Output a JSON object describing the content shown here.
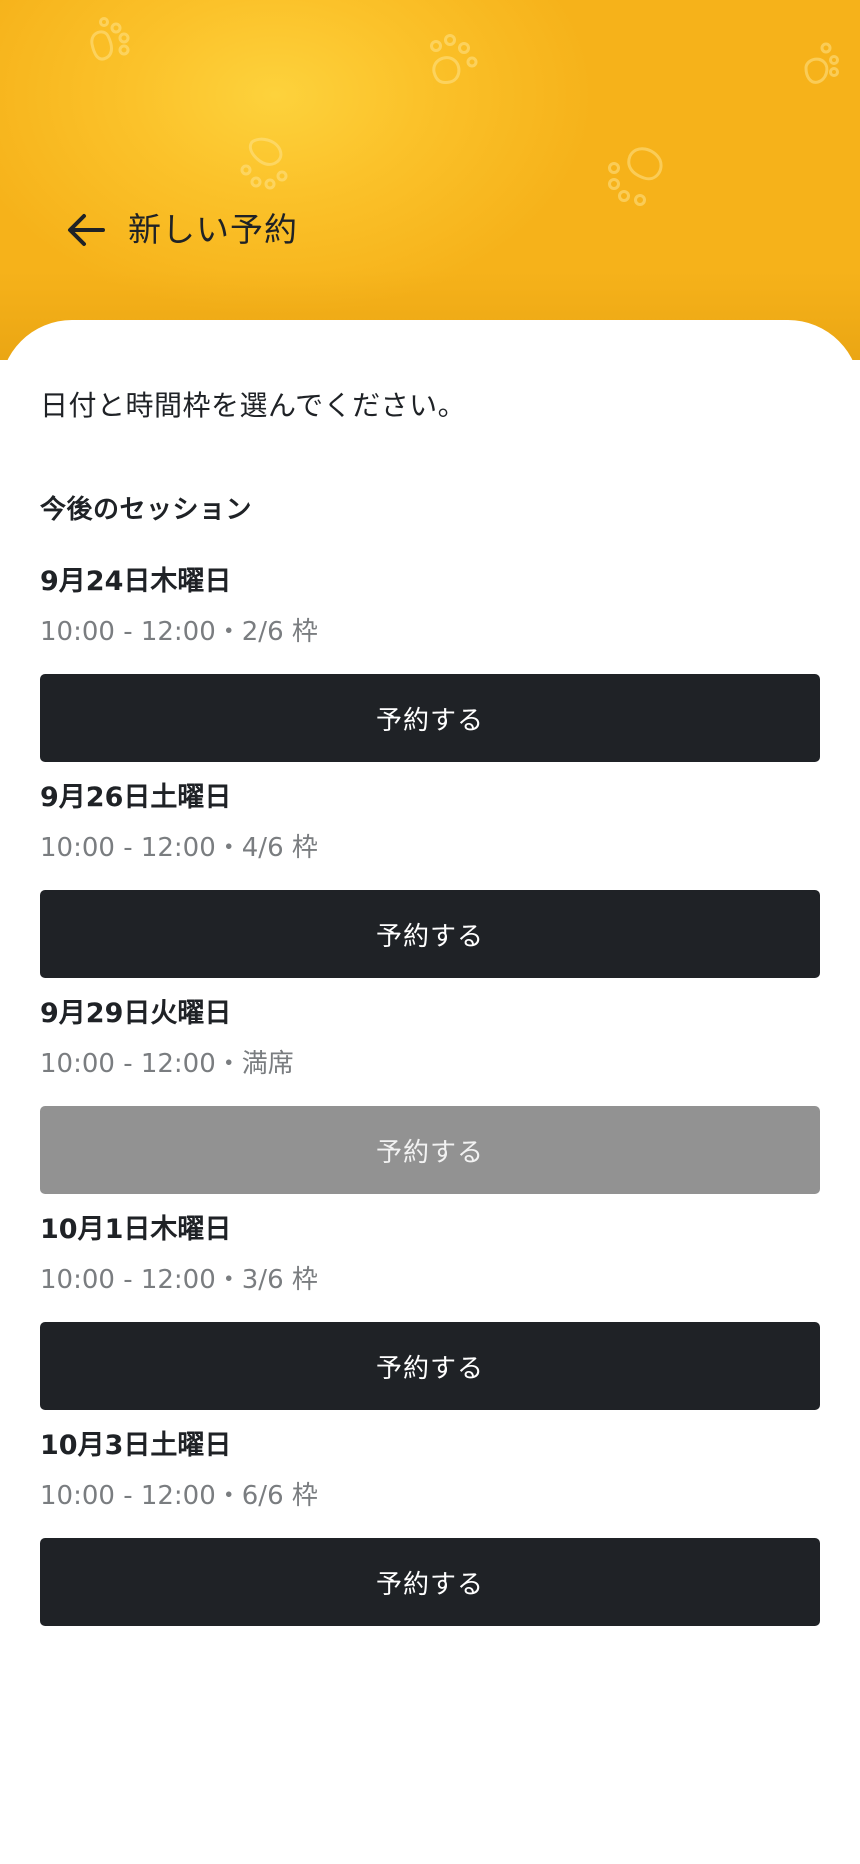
{
  "header": {
    "title": "新しい予約",
    "back_icon": "arrow-left-icon",
    "background_color": "#f6b21a"
  },
  "instruction": "日付と時間枠を選んでください。",
  "section_title": "今後のセッション",
  "sessions": [
    {
      "date": "9月24日木曜日",
      "time": "10:00 - 12:00・2/6 枠",
      "button_label": "予約する",
      "disabled": false
    },
    {
      "date": "9月26日土曜日",
      "time": "10:00 - 12:00・4/6 枠",
      "button_label": "予約する",
      "disabled": false
    },
    {
      "date": "9月29日火曜日",
      "time": "10:00 - 12:00・満席",
      "button_label": "予約する",
      "disabled": true
    },
    {
      "date": "10月1日木曜日",
      "time": "10:00 - 12:00・3/6 枠",
      "button_label": "予約する",
      "disabled": false
    },
    {
      "date": "10月3日土曜日",
      "time": "10:00 - 12:00・6/6 枠",
      "button_label": "予約する",
      "disabled": false
    }
  ],
  "colors": {
    "button_primary": "#1f2226",
    "button_disabled": "#929292",
    "text_secondary": "#7a7d80"
  }
}
